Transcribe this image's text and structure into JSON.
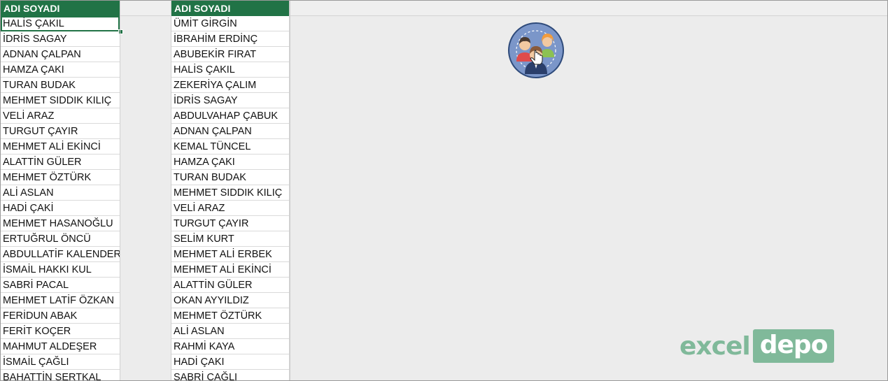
{
  "column_a": {
    "header": "ADI SOYADI",
    "rows": [
      "HALİS ÇAKIL",
      "İDRİS SAGAY",
      "ADNAN ÇALPAN",
      "HAMZA ÇAKI",
      "TURAN BUDAK",
      "MEHMET SIDDIK KILIÇ",
      "VELİ ARAZ",
      "TURGUT ÇAYIR",
      "MEHMET ALİ EKİNCİ",
      "ALATTİN GÜLER",
      "MEHMET ÖZTÜRK",
      "ALİ ASLAN",
      "HADİ ÇAKİ",
      "MEHMET HASANOĞLU",
      "ERTUĞRUL ÖNCÜ",
      "ABDULLATİF KALENDER",
      "İSMAİL HAKKI KUL",
      "SABRİ PACAL",
      "MEHMET LATİF ÖZKAN",
      "FERİDUN ABAK",
      "FERİT KOÇER",
      "MAHMUT ALDEŞER",
      "İSMAİL ÇAĞLI",
      "BAHATTİN SERTKAL"
    ]
  },
  "column_b": {
    "header": "ADI SOYADI",
    "rows": [
      "ÜMİT GİRGİN",
      "İBRAHİM ERDİNÇ",
      "ABUBEKİR FIRAT",
      "HALİS ÇAKIL",
      "ZEKERİYA ÇALIM",
      "İDRİS SAGAY",
      "ABDULVAHAP ÇABUK",
      "ADNAN ÇALPAN",
      "KEMAL TÜNCEL",
      "HAMZA ÇAKI",
      "TURAN BUDAK",
      "MEHMET SIDDIK KILIÇ",
      "VELİ ARAZ",
      "TURGUT ÇAYIR",
      "SELİM KURT",
      "MEHMET ALİ ERBEK",
      "MEHMET ALİ EKİNCİ",
      "ALATTİN GÜLER",
      "OKAN AYYILDIZ",
      "MEHMET ÖZTÜRK",
      "ALİ ASLAN",
      "RAHMİ KAYA",
      "HADİ ÇAKI",
      "SABRİ ÇAĞLI"
    ]
  },
  "icons": {
    "users_button": "users-group-click-icon"
  },
  "logo": {
    "left": "excel",
    "right": "depo"
  },
  "colors": {
    "header_bg": "#217346",
    "logo": "#80b99a",
    "icon_circle": "#7b96c9"
  }
}
